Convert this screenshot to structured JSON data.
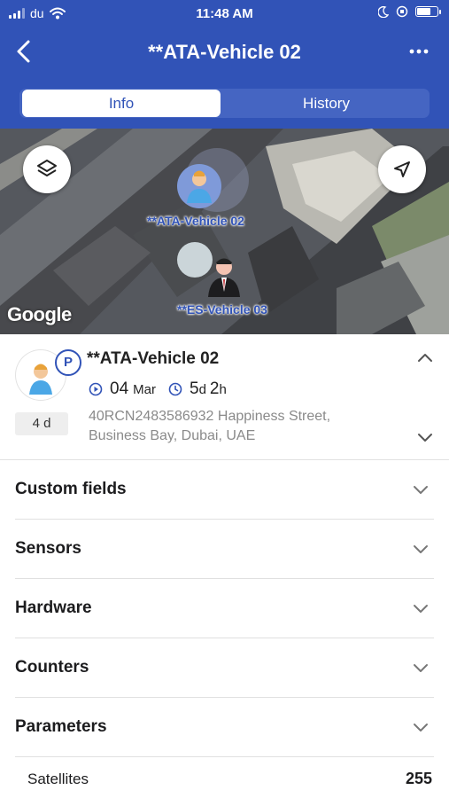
{
  "status_bar": {
    "carrier": "du",
    "time": "11:48 AM",
    "battery_percent": 70
  },
  "nav": {
    "title": "**ATA-Vehicle 02",
    "back_icon": "chevron-left-icon",
    "more_icon": "ellipsis-icon"
  },
  "tabs": [
    {
      "label": "Info",
      "active": true
    },
    {
      "label": "History",
      "active": false
    }
  ],
  "map": {
    "layers_icon": "layers-icon",
    "locate_icon": "navigation-arrow-icon",
    "markers": [
      {
        "label": "**ATA-Vehicle 02"
      },
      {
        "label": "**ES-Vehicle 03"
      }
    ],
    "attribution": "Google"
  },
  "summary": {
    "title": "**ATA-Vehicle 02",
    "badge": "P",
    "days": "4 d",
    "date_day": "04",
    "date_month": "Mar",
    "duration_days": "5",
    "duration_days_unit": "d",
    "duration_hours": "2",
    "duration_hours_unit": "h",
    "address_line1": "40RCN2483586932 Happiness Street,",
    "address_line2": "Business Bay, Dubai, UAE"
  },
  "sections": [
    {
      "label": "Custom fields"
    },
    {
      "label": "Sensors"
    },
    {
      "label": "Hardware"
    },
    {
      "label": "Counters"
    },
    {
      "label": "Parameters"
    }
  ],
  "parameters": [
    {
      "label": "Satellites",
      "value": "255"
    }
  ],
  "colors": {
    "brand": "#3153b7",
    "tab_track": "#4565c2",
    "muted_text": "#8a8a8a"
  }
}
